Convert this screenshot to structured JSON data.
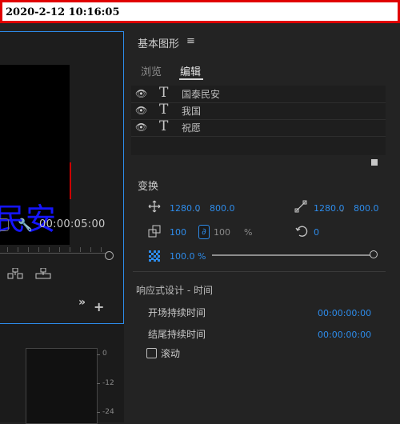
{
  "topbar": {
    "timestamp": "2020-2-12 10:16:05"
  },
  "program_monitor": {
    "preview_text": "民安",
    "timecode": "00:00:05:00",
    "icons": [
      "dropdown-icon",
      "wrench-icon",
      "insert-icon",
      "overwrite-icon",
      "more-icon",
      "add-icon"
    ]
  },
  "audio_meter": {
    "db_labels": [
      "0",
      "-12",
      "-24"
    ]
  },
  "essential_graphics": {
    "title": "基本图形",
    "menu_glyph": "≡",
    "tabs": [
      {
        "label": "浏览",
        "active": false
      },
      {
        "label": "编辑",
        "active": true
      }
    ],
    "layers": [
      {
        "name": "国泰民安",
        "type_glyph": "T",
        "visible": true
      },
      {
        "name": "我国",
        "type_glyph": "T",
        "visible": true
      },
      {
        "name": "祝愿",
        "type_glyph": "T",
        "visible": true
      }
    ],
    "transform": {
      "title": "变换",
      "position": {
        "x": "1280.0",
        "sep": ",",
        "y": "800.0"
      },
      "anchor": {
        "x": "1280.0",
        "sep": ",",
        "y": "800.0"
      },
      "scale": {
        "value": "100",
        "height": "100",
        "unit": "%"
      },
      "rotation": {
        "value": "0"
      },
      "opacity": {
        "value": "100.0 %",
        "level": 1.0
      }
    },
    "responsive": {
      "title": "响应式设计 - 时间",
      "intro_label": "开场持续时间",
      "intro_value": "00:00:00:00",
      "outro_label": "结尾持续时间",
      "outro_value": "00:00:00:00",
      "scroll_label": "滚动",
      "scroll_checked": false
    }
  },
  "colors": {
    "accent": "#2d8ceb",
    "highlight": "#e00000",
    "text_blue": "#1515ff"
  }
}
